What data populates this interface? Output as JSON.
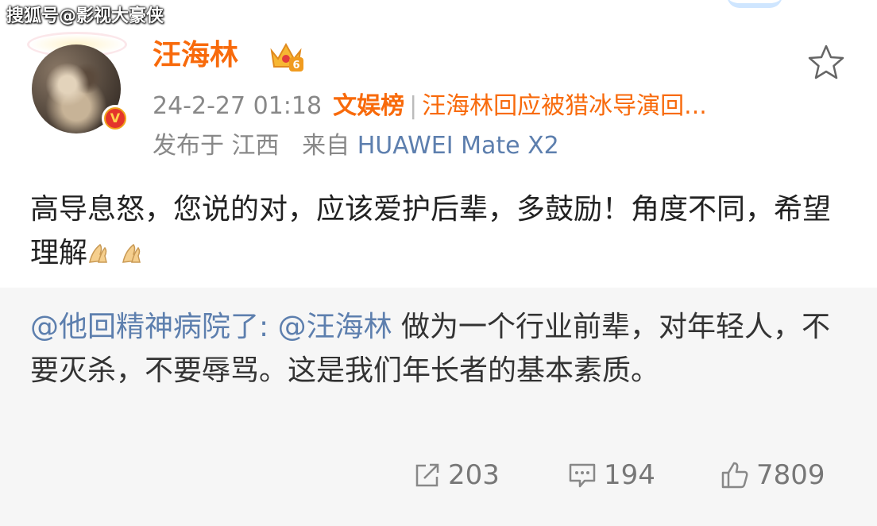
{
  "watermark": "搜狐号@影视大豪侠",
  "user": {
    "name": "汪海林",
    "vip_level": "6"
  },
  "meta": {
    "timestamp": "24-2-27 01:18",
    "hot_label": "文娱榜",
    "hot_title": "汪海林回应被猎冰导演回...",
    "location_text": "发布于 江西",
    "from_label": "来自",
    "device": "HUAWEI Mate X2"
  },
  "post": {
    "text": "高导息怒，您说的对，应该爱护后辈，多鼓励！角度不同，希望理解"
  },
  "repost": {
    "author_mention": "@他回精神病院了:",
    "inner_mention": "@汪海林",
    "text": " 做为一个行业前辈，对年轻人，不要灭杀，不要辱骂。这是我们年长者的基本素质。"
  },
  "actions": {
    "shares": "203",
    "comments": "194",
    "likes": "7809"
  },
  "colors": {
    "username": "#f86a0b",
    "link": "#5d7fae",
    "meta": "#888888",
    "repost_bg": "#f6f6f6"
  },
  "icons": [
    "verified-badge-icon",
    "vip-crown-icon",
    "favorite-star-icon",
    "folded-hands-emoji",
    "share-icon",
    "comment-icon",
    "like-icon"
  ]
}
